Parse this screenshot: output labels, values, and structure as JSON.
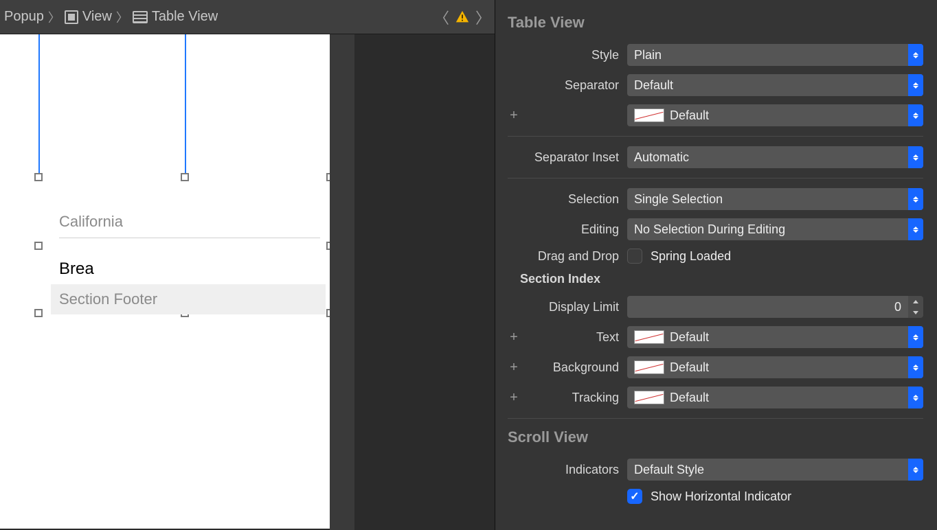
{
  "breadcrumb": {
    "item0": "Popup",
    "item1": "View",
    "item2": "Table View"
  },
  "canvas": {
    "section_header": "California",
    "cell_text": "Brea",
    "section_footer": "Section Footer"
  },
  "inspector": {
    "tableview_title": "Table View",
    "style_label": "Style",
    "style_value": "Plain",
    "separator_label": "Separator",
    "separator_value": "Default",
    "separator_color_value": "Default",
    "separator_inset_label": "Separator Inset",
    "separator_inset_value": "Automatic",
    "selection_label": "Selection",
    "selection_value": "Single Selection",
    "editing_label": "Editing",
    "editing_value": "No Selection During Editing",
    "dragdrop_label": "Drag and Drop",
    "dragdrop_checkbox": "Spring Loaded",
    "section_index_title": "Section Index",
    "display_limit_label": "Display Limit",
    "display_limit_value": "0",
    "text_label": "Text",
    "text_value": "Default",
    "background_label": "Background",
    "background_value": "Default",
    "tracking_label": "Tracking",
    "tracking_value": "Default",
    "scrollview_title": "Scroll View",
    "indicators_label": "Indicators",
    "indicators_value": "Default Style",
    "show_horizontal": "Show Horizontal Indicator"
  }
}
